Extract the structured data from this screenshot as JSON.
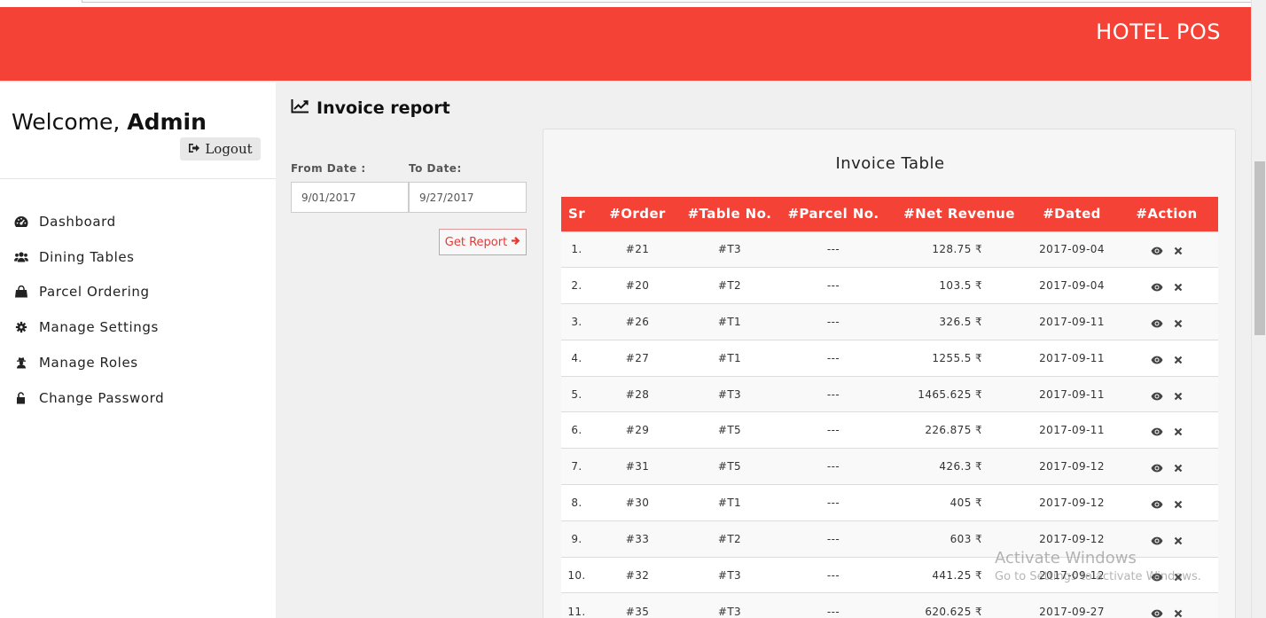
{
  "header": {
    "brand": "HOTEL POS"
  },
  "sidebar": {
    "welcome_prefix": "Welcome, ",
    "welcome_user": "Admin",
    "logout_label": "Logout",
    "items": [
      {
        "label": "Dashboard",
        "icon": "dashboard-icon"
      },
      {
        "label": "Dining Tables",
        "icon": "users-icon"
      },
      {
        "label": "Parcel Ordering",
        "icon": "shopping-bag-icon"
      },
      {
        "label": "Manage Settings",
        "icon": "gear-icon"
      },
      {
        "label": "Manage Roles",
        "icon": "user-secret-icon"
      },
      {
        "label": "Change Password",
        "icon": "unlock-icon"
      }
    ]
  },
  "main": {
    "title": "Invoice report",
    "title_icon": "line-chart-icon",
    "from_label": "From Date :",
    "to_label": "To Date:",
    "from_value": "9/01/2017",
    "to_value": "9/27/2017",
    "get_report_label": "Get Report"
  },
  "invoice_table": {
    "title": "Invoice Table",
    "columns": [
      "Sr",
      "#Order",
      "#Table No.",
      "#Parcel No.",
      "#Net Revenue",
      "#Dated",
      "#Action"
    ],
    "rows": [
      {
        "sr": "1.",
        "order": "#21",
        "table": "#T3",
        "parcel": "---",
        "revenue": "128.75 ₹",
        "dated": "2017-09-04"
      },
      {
        "sr": "2.",
        "order": "#20",
        "table": "#T2",
        "parcel": "---",
        "revenue": "103.5 ₹",
        "dated": "2017-09-04"
      },
      {
        "sr": "3.",
        "order": "#26",
        "table": "#T1",
        "parcel": "---",
        "revenue": "326.5 ₹",
        "dated": "2017-09-11"
      },
      {
        "sr": "4.",
        "order": "#27",
        "table": "#T1",
        "parcel": "---",
        "revenue": "1255.5 ₹",
        "dated": "2017-09-11"
      },
      {
        "sr": "5.",
        "order": "#28",
        "table": "#T3",
        "parcel": "---",
        "revenue": "1465.625 ₹",
        "dated": "2017-09-11"
      },
      {
        "sr": "6.",
        "order": "#29",
        "table": "#T5",
        "parcel": "---",
        "revenue": "226.875 ₹",
        "dated": "2017-09-11"
      },
      {
        "sr": "7.",
        "order": "#31",
        "table": "#T5",
        "parcel": "---",
        "revenue": "426.3 ₹",
        "dated": "2017-09-12"
      },
      {
        "sr": "8.",
        "order": "#30",
        "table": "#T1",
        "parcel": "---",
        "revenue": "405 ₹",
        "dated": "2017-09-12"
      },
      {
        "sr": "9.",
        "order": "#33",
        "table": "#T2",
        "parcel": "---",
        "revenue": "603 ₹",
        "dated": "2017-09-12"
      },
      {
        "sr": "10.",
        "order": "#32",
        "table": "#T3",
        "parcel": "---",
        "revenue": "441.25 ₹",
        "dated": "2017-09-12"
      },
      {
        "sr": "11.",
        "order": "#35",
        "table": "#T3",
        "parcel": "---",
        "revenue": "620.625 ₹",
        "dated": "2017-09-27"
      }
    ]
  },
  "watermark": {
    "line1": "Activate Windows",
    "line2": "Go to Settings to activate Windows."
  },
  "colors": {
    "accent": "#f44336",
    "page_bg": "#f0f0f0"
  }
}
